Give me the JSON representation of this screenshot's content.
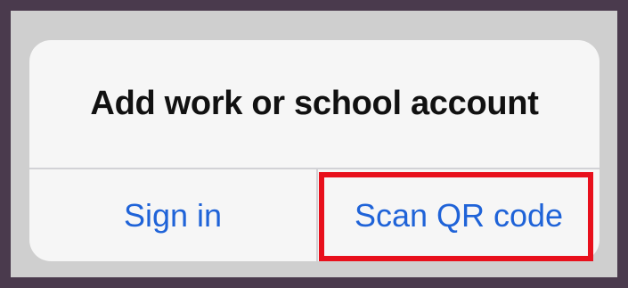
{
  "dialog": {
    "title": "Add work or school account",
    "actions": [
      {
        "label": "Sign in"
      },
      {
        "label": "Scan QR code",
        "highlighted": true
      }
    ]
  },
  "colors": {
    "action_text": "#1f63d8",
    "highlight": "#e8101c",
    "title_text": "#111111",
    "dialog_bg": "#f6f6f6"
  }
}
